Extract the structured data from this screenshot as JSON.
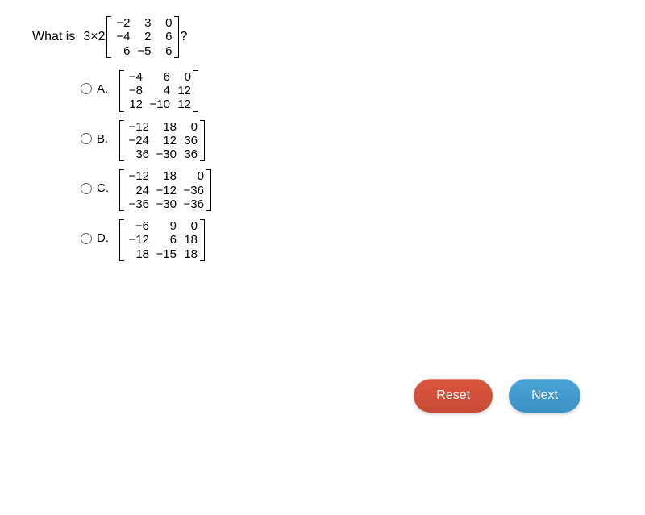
{
  "question_prefix": "What is",
  "scalar": "3×2",
  "question_matrix": [
    [
      "−2",
      "3",
      "0"
    ],
    [
      "−4",
      "2",
      "6"
    ],
    [
      "6",
      "−5",
      "6"
    ]
  ],
  "question_suffix": "?",
  "choices": [
    {
      "label": "A.",
      "matrix": [
        [
          "−4",
          "6",
          "0"
        ],
        [
          "−8",
          "4",
          "12"
        ],
        [
          "12",
          "−10",
          "12"
        ]
      ]
    },
    {
      "label": "B.",
      "matrix": [
        [
          "−12",
          "18",
          "0"
        ],
        [
          "−24",
          "12",
          "36"
        ],
        [
          "36",
          "−30",
          "36"
        ]
      ]
    },
    {
      "label": "C.",
      "matrix": [
        [
          "−12",
          "18",
          "0"
        ],
        [
          "24",
          "−12",
          "−36"
        ],
        [
          "−36",
          "−30",
          "−36"
        ]
      ]
    },
    {
      "label": "D.",
      "matrix": [
        [
          "−6",
          "9",
          "0"
        ],
        [
          "−12",
          "6",
          "18"
        ],
        [
          "18",
          "−15",
          "18"
        ]
      ]
    }
  ],
  "buttons": {
    "reset": "Reset",
    "next": "Next"
  }
}
